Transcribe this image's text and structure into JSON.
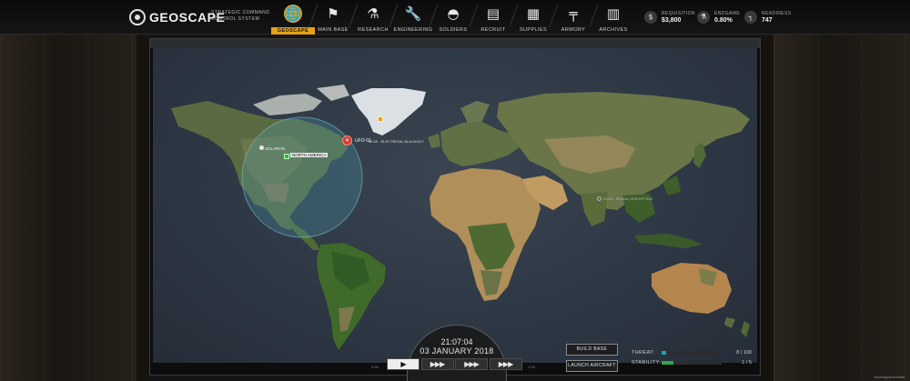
{
  "app": {
    "title": "GEOSCAPE",
    "subtitle": "STRATEGIC COMMAND CONTROL SYSTEM"
  },
  "nav": {
    "active": "GEOSCAPE",
    "tabs": [
      {
        "label": "GEOSCAPE",
        "icon": "globe-icon",
        "glyph": "🌐"
      },
      {
        "label": "MAIN BASE",
        "icon": "flag-icon",
        "glyph": "⚑"
      },
      {
        "label": "RESEARCH",
        "icon": "microscope-icon",
        "glyph": "⚗"
      },
      {
        "label": "ENGINEERING",
        "icon": "wrench-icon",
        "glyph": "🔧"
      },
      {
        "label": "SOLDIERS",
        "icon": "helmet-icon",
        "glyph": "◓"
      },
      {
        "label": "RECRUIT",
        "icon": "recruit-file-icon",
        "glyph": "▤"
      },
      {
        "label": "SUPPLIES",
        "icon": "crates-icon",
        "glyph": "▦"
      },
      {
        "label": "ARMORY",
        "icon": "rifle-icon",
        "glyph": "╤"
      },
      {
        "label": "ARCHIVES",
        "icon": "documents-icon",
        "glyph": "▥"
      }
    ]
  },
  "stats": {
    "requisition": {
      "label": "REQUISITION",
      "value": "$3,800",
      "icon": "money-icon",
      "glyph": "$"
    },
    "endgame": {
      "label": "ENDGAME",
      "value": "0.80%",
      "icon": "flask-icon",
      "glyph": "⚗"
    },
    "readiness": {
      "label": "READINESS",
      "value": "747",
      "icon": "pistol-icon",
      "glyph": "┐"
    }
  },
  "map": {
    "markers": {
      "ufo": {
        "label": "UFO-01",
        "detail": "00:30 - ELECTRICAL BLACKOUT",
        "icon": "ufo-alert-icon"
      },
      "base_name": "SOLARON",
      "region_name": "NORTH AMERICA",
      "signal": {
        "detail": "01:03 - SIGNAL DISRUPTION",
        "icon": "signal-icon"
      },
      "greenland_icon": "beacon-icon"
    }
  },
  "clock": {
    "time": "21:07:04",
    "date": "03 JANUARY 2018"
  },
  "speed": {
    "min_label": "0.5X",
    "max_label": "1.0X",
    "buttons": [
      {
        "label": "▶",
        "active": true
      },
      {
        "label": "▶▶▶",
        "active": false
      },
      {
        "label": "▶▶▶",
        "active": false
      },
      {
        "label": "▶▶▶",
        "active": false
      }
    ]
  },
  "actions": {
    "build_base": "BUILD BASE",
    "launch_aircraft": "LAUNCH AIRCRAFT"
  },
  "meters": {
    "threat": {
      "label": "THREAT:",
      "value": "8 / 100",
      "fraction": 0.08,
      "color": "#1aa3b8"
    },
    "stability": {
      "label": "STABILITY:",
      "value": "1 / 5",
      "fraction": 0.2,
      "color": "#2ea84d"
    }
  },
  "footer": "Development Build",
  "colors": {
    "accent": "#e6a117",
    "alert": "#d33a2c",
    "region": "#2fbf3c",
    "radar": "#4a9fb0"
  }
}
